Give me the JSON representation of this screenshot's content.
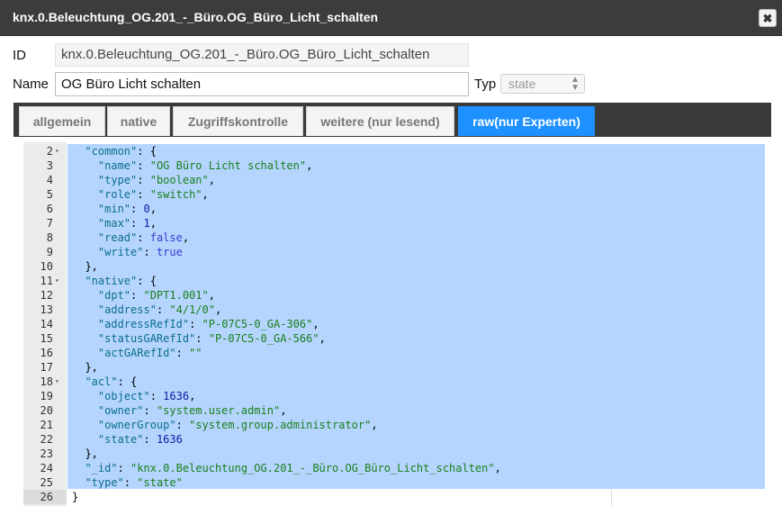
{
  "window": {
    "title": "knx.0.Beleuchtung_OG.201_-_Büro.OG_Büro_Licht_schalten",
    "close_glyph": "✖"
  },
  "form": {
    "id_label": "ID",
    "id_value": "knx.0.Beleuchtung_OG.201_-_Büro.OG_Büro_Licht_schalten",
    "name_label": "Name",
    "name_value": "OG Büro Licht schalten",
    "type_label": "Typ",
    "type_value": "state"
  },
  "tabs": [
    {
      "label": "allgemein",
      "active": false
    },
    {
      "label": "native",
      "active": false
    },
    {
      "label": "Zugriffskontrolle",
      "active": false
    },
    {
      "label": "weitere (nur lesend)",
      "active": false
    },
    {
      "label": "raw(nur Experten)",
      "active": true
    }
  ],
  "editor": {
    "lines": [
      {
        "n": "2",
        "fold": true,
        "tokens": [
          [
            "p",
            "  "
          ],
          [
            "k",
            "\"common\""
          ],
          [
            "p",
            ": {"
          ]
        ]
      },
      {
        "n": "3",
        "fold": false,
        "tokens": [
          [
            "p",
            "    "
          ],
          [
            "k",
            "\"name\""
          ],
          [
            "p",
            ": "
          ],
          [
            "s2",
            "\"OG Büro Licht schalten\""
          ],
          [
            "p",
            ","
          ]
        ]
      },
      {
        "n": "4",
        "fold": false,
        "tokens": [
          [
            "p",
            "    "
          ],
          [
            "k",
            "\"type\""
          ],
          [
            "p",
            ": "
          ],
          [
            "s2",
            "\"boolean\""
          ],
          [
            "p",
            ","
          ]
        ]
      },
      {
        "n": "5",
        "fold": false,
        "tokens": [
          [
            "p",
            "    "
          ],
          [
            "k",
            "\"role\""
          ],
          [
            "p",
            ": "
          ],
          [
            "s2",
            "\"switch\""
          ],
          [
            "p",
            ","
          ]
        ]
      },
      {
        "n": "6",
        "fold": false,
        "tokens": [
          [
            "p",
            "    "
          ],
          [
            "k",
            "\"min\""
          ],
          [
            "p",
            ": "
          ],
          [
            "n",
            "0"
          ],
          [
            "p",
            ","
          ]
        ]
      },
      {
        "n": "7",
        "fold": false,
        "tokens": [
          [
            "p",
            "    "
          ],
          [
            "k",
            "\"max\""
          ],
          [
            "p",
            ": "
          ],
          [
            "n",
            "1"
          ],
          [
            "p",
            ","
          ]
        ]
      },
      {
        "n": "8",
        "fold": false,
        "tokens": [
          [
            "p",
            "    "
          ],
          [
            "k",
            "\"read\""
          ],
          [
            "p",
            ": "
          ],
          [
            "b",
            "false"
          ],
          [
            "p",
            ","
          ]
        ]
      },
      {
        "n": "9",
        "fold": false,
        "tokens": [
          [
            "p",
            "    "
          ],
          [
            "k",
            "\"write\""
          ],
          [
            "p",
            ": "
          ],
          [
            "b",
            "true"
          ]
        ]
      },
      {
        "n": "10",
        "fold": false,
        "tokens": [
          [
            "p",
            "  },"
          ]
        ]
      },
      {
        "n": "11",
        "fold": true,
        "tokens": [
          [
            "p",
            "  "
          ],
          [
            "k",
            "\"native\""
          ],
          [
            "p",
            ": {"
          ]
        ]
      },
      {
        "n": "12",
        "fold": false,
        "tokens": [
          [
            "p",
            "    "
          ],
          [
            "k",
            "\"dpt\""
          ],
          [
            "p",
            ": "
          ],
          [
            "s2",
            "\"DPT1.001\""
          ],
          [
            "p",
            ","
          ]
        ]
      },
      {
        "n": "13",
        "fold": false,
        "tokens": [
          [
            "p",
            "    "
          ],
          [
            "k",
            "\"address\""
          ],
          [
            "p",
            ": "
          ],
          [
            "s2",
            "\"4/1/0\""
          ],
          [
            "p",
            ","
          ]
        ]
      },
      {
        "n": "14",
        "fold": false,
        "tokens": [
          [
            "p",
            "    "
          ],
          [
            "k",
            "\"addressRefId\""
          ],
          [
            "p",
            ": "
          ],
          [
            "s2",
            "\"P-07C5-0_GA-306\""
          ],
          [
            "p",
            ","
          ]
        ]
      },
      {
        "n": "15",
        "fold": false,
        "tokens": [
          [
            "p",
            "    "
          ],
          [
            "k",
            "\"statusGARefId\""
          ],
          [
            "p",
            ": "
          ],
          [
            "s2",
            "\"P-07C5-0_GA-566\""
          ],
          [
            "p",
            ","
          ]
        ]
      },
      {
        "n": "16",
        "fold": false,
        "tokens": [
          [
            "p",
            "    "
          ],
          [
            "k",
            "\"actGARefId\""
          ],
          [
            "p",
            ": "
          ],
          [
            "s2",
            "\"\""
          ]
        ]
      },
      {
        "n": "17",
        "fold": false,
        "tokens": [
          [
            "p",
            "  },"
          ]
        ]
      },
      {
        "n": "18",
        "fold": true,
        "tokens": [
          [
            "p",
            "  "
          ],
          [
            "k",
            "\"acl\""
          ],
          [
            "p",
            ": {"
          ]
        ]
      },
      {
        "n": "19",
        "fold": false,
        "tokens": [
          [
            "p",
            "    "
          ],
          [
            "k",
            "\"object\""
          ],
          [
            "p",
            ": "
          ],
          [
            "n",
            "1636"
          ],
          [
            "p",
            ","
          ]
        ]
      },
      {
        "n": "20",
        "fold": false,
        "tokens": [
          [
            "p",
            "    "
          ],
          [
            "k",
            "\"owner\""
          ],
          [
            "p",
            ": "
          ],
          [
            "s2",
            "\"system.user.admin\""
          ],
          [
            "p",
            ","
          ]
        ]
      },
      {
        "n": "21",
        "fold": false,
        "tokens": [
          [
            "p",
            "    "
          ],
          [
            "k",
            "\"ownerGroup\""
          ],
          [
            "p",
            ": "
          ],
          [
            "s2",
            "\"system.group.administrator\""
          ],
          [
            "p",
            ","
          ]
        ]
      },
      {
        "n": "22",
        "fold": false,
        "tokens": [
          [
            "p",
            "    "
          ],
          [
            "k",
            "\"state\""
          ],
          [
            "p",
            ": "
          ],
          [
            "n",
            "1636"
          ]
        ]
      },
      {
        "n": "23",
        "fold": false,
        "tokens": [
          [
            "p",
            "  },"
          ]
        ]
      },
      {
        "n": "24",
        "fold": false,
        "tokens": [
          [
            "p",
            "  "
          ],
          [
            "k",
            "\"_id\""
          ],
          [
            "p",
            ": "
          ],
          [
            "s2",
            "\"knx.0.Beleuchtung_OG.201_-_Büro.OG_Büro_Licht_schalten\""
          ],
          [
            "p",
            ","
          ]
        ]
      },
      {
        "n": "25",
        "fold": false,
        "tokens": [
          [
            "p",
            "  "
          ],
          [
            "k",
            "\"type\""
          ],
          [
            "p",
            ": "
          ],
          [
            "s2",
            "\"state\""
          ]
        ]
      },
      {
        "n": "26",
        "fold": false,
        "tokens": [
          [
            "p",
            "}"
          ]
        ]
      }
    ]
  }
}
